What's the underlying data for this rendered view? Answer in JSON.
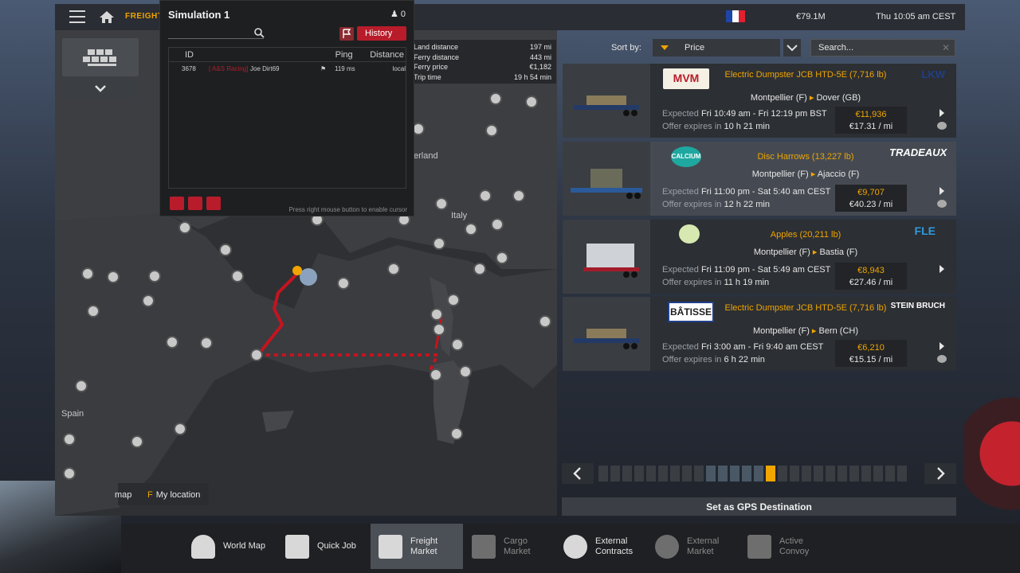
{
  "topbar": {
    "breadcrumb": "FREIGHT MARKET",
    "money": "€79.1M",
    "datetime": "Thu 10:05 am CEST",
    "flag_colors": [
      "#1f45a8",
      "#ffffff",
      "#e02030"
    ]
  },
  "map": {
    "labels": {
      "switzerland": "erland",
      "italy": "Italy",
      "spain": "Spain",
      "map_short": "map"
    },
    "my_location_key": "F",
    "my_location_label": "My location",
    "route_color": "#c4141f"
  },
  "ferry_info": {
    "rows": [
      {
        "label": "Land distance",
        "value": "197 mi"
      },
      {
        "label": "Ferry distance",
        "value": "443 mi"
      },
      {
        "label": "Ferry price",
        "value": "€1,182"
      },
      {
        "label": "Trip time",
        "value": "19 h 54 min"
      }
    ]
  },
  "simulation": {
    "title": "Simulation 1",
    "player_count": "0",
    "history_label": "History",
    "columns": [
      "ID",
      "Ping",
      "Distance"
    ],
    "rows": [
      {
        "id": "3678",
        "tag": "[ A&S Racing]",
        "name": "Joe Dirt69",
        "ping": "119 ms",
        "distance": "local"
      }
    ],
    "hint": "Press right mouse button to enable cursor"
  },
  "sort": {
    "label": "Sort by:",
    "value": "Price",
    "search_placeholder": "Search..."
  },
  "offers": [
    {
      "source_company": "MVM",
      "cargo": "Electric Dumpster JCB HTD-5E (7,716 lb)",
      "from": "Montpellier (F)",
      "to": "Dover (GB)",
      "expected_label": "Expected",
      "expected": "Fri 10:49 am - Fri 12:19 pm BST",
      "expires_label": "Offer expires in",
      "expires": "10 h 21 min",
      "price": "€11,936",
      "rate": "€17.31 / mi",
      "dest_company": "LKW"
    },
    {
      "source_company": "CALCIUM",
      "cargo": "Disc Harrows (13,227 lb)",
      "from": "Montpellier (F)",
      "to": "Ajaccio (F)",
      "expected_label": "Expected",
      "expected": "Fri 11:00 pm - Sat 5:40 am CEST",
      "expires_label": "Offer expires in",
      "expires": "12 h 22 min",
      "price": "€9,707",
      "rate": "€40.23 / mi",
      "dest_company": "TRADEAUX"
    },
    {
      "source_company": "",
      "cargo": "Apples (20,211 lb)",
      "from": "Montpellier (F)",
      "to": "Bastia (F)",
      "expected_label": "Expected",
      "expected": "Fri 11:09 pm - Sat 5:49 am CEST",
      "expires_label": "Offer expires in",
      "expires": "11 h 19 min",
      "price": "€8,943",
      "rate": "€27.46 / mi",
      "dest_company": "FLE"
    },
    {
      "source_company": "BÂTISSE",
      "cargo": "Electric Dumpster JCB HTD-5E (7,716 lb)",
      "from": "Montpellier (F)",
      "to": "Bern (CH)",
      "expected_label": "Expected",
      "expected": "Fri 3:00 am - Fri 9:40 am CEST",
      "expires_label": "Offer expires in",
      "expires": "6 h 22 min",
      "price": "€6,210",
      "rate": "€15.15 / mi",
      "dest_company": "STEIN BRUCH"
    }
  ],
  "pager": {
    "total": 26,
    "current": 15
  },
  "gps_button": "Set as GPS Destination",
  "tabs": [
    {
      "label": "World Map",
      "state": "normal"
    },
    {
      "label": "Quick Job",
      "state": "normal"
    },
    {
      "label": "Freight Market",
      "state": "active"
    },
    {
      "label": "Cargo Market",
      "state": "dim"
    },
    {
      "label": "External Contracts",
      "state": "normal"
    },
    {
      "label": "External Market",
      "state": "dim"
    },
    {
      "label": "Active Convoy",
      "state": "dim"
    }
  ],
  "colors": {
    "accent": "#f0a500",
    "brand_red": "#b81c2a",
    "panel": "#2c2f33"
  }
}
